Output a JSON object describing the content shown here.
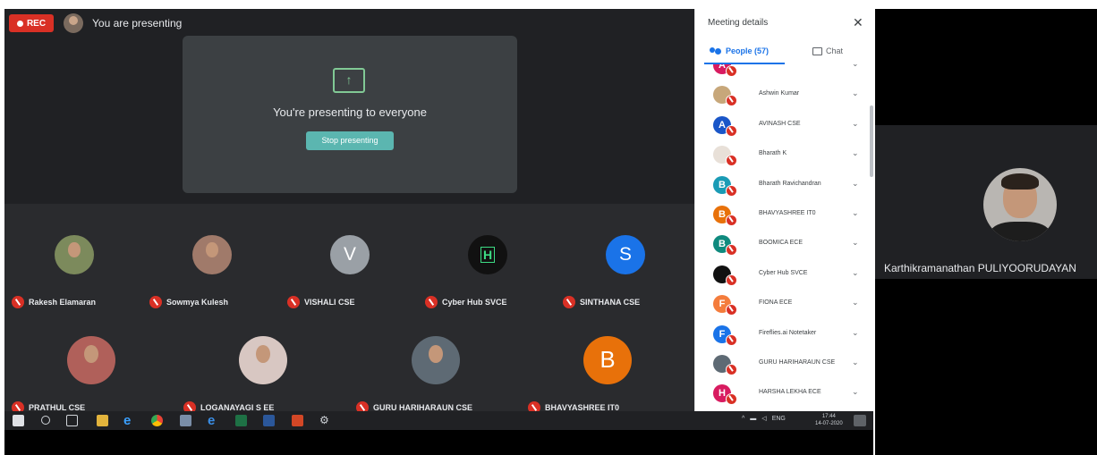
{
  "meet": {
    "rec_label": "REC",
    "presenting_label": "You are presenting",
    "present_card": {
      "title": "You're presenting to everyone",
      "stop_button": "Stop presenting"
    }
  },
  "tiles": [
    {
      "name": "Rakesh Elamaran",
      "initial": "",
      "type": "photo",
      "color": "#7c8a5c"
    },
    {
      "name": "Sowmya Kulesh",
      "initial": "",
      "type": "photo",
      "color": "#a07a6a"
    },
    {
      "name": "VISHALI CSE",
      "initial": "V",
      "type": "letter",
      "color": "#9aa0a6"
    },
    {
      "name": "Cyber Hub SVCE",
      "initial": "",
      "type": "logo",
      "color": "#111111"
    },
    {
      "name": "SINTHANA CSE",
      "initial": "S",
      "type": "letter",
      "color": "#1a73e8"
    },
    {
      "name": "PRATHUL CSE",
      "initial": "",
      "type": "photo",
      "color": "#b0605a"
    },
    {
      "name": "LOGANAYAGI S EE",
      "initial": "",
      "type": "photo",
      "color": "#d8c7c2"
    },
    {
      "name": "GURU HARIHARAUN CSE",
      "initial": "",
      "type": "photo",
      "color": "#5e6a74"
    },
    {
      "name": "BHAVYASHREE IT0",
      "initial": "B",
      "type": "letter",
      "color": "#e8710a"
    }
  ],
  "panel": {
    "title": "Meeting details",
    "people_tab": "People (57)",
    "chat_tab": "Chat",
    "people": [
      {
        "name": "",
        "initial": "A",
        "color": "#d81b60"
      },
      {
        "name": "Ashwin Kumar",
        "initial": "",
        "color": "#c7a77a"
      },
      {
        "name": "AVINASH CSE",
        "initial": "A",
        "color": "#1a56c8"
      },
      {
        "name": "Bharath K",
        "initial": "",
        "color": "#e8e0d8"
      },
      {
        "name": "Bharath Ravichandran",
        "initial": "B",
        "color": "#1a9bb5"
      },
      {
        "name": "BHAVYASHREE IT0",
        "initial": "B",
        "color": "#e8710a"
      },
      {
        "name": "BOOMICA ECE",
        "initial": "B",
        "color": "#0f8a7e"
      },
      {
        "name": "Cyber Hub SVCE",
        "initial": "",
        "color": "#111111"
      },
      {
        "name": "FIONA ECE",
        "initial": "F",
        "color": "#f47c3c"
      },
      {
        "name": "Fireflies.ai Notetaker",
        "initial": "F",
        "color": "#1a73e8"
      },
      {
        "name": "GURU HARIHARAUN CSE",
        "initial": "",
        "color": "#5e6a74"
      },
      {
        "name": "HARSHA LEKHA ECE",
        "initial": "H",
        "color": "#d81b60"
      }
    ]
  },
  "speaker": {
    "name": "Karthikramanathan PULIYOORUDAYAN"
  },
  "taskbar": {
    "language": "ENG",
    "time": "17:44",
    "date": "14-07-2020"
  }
}
